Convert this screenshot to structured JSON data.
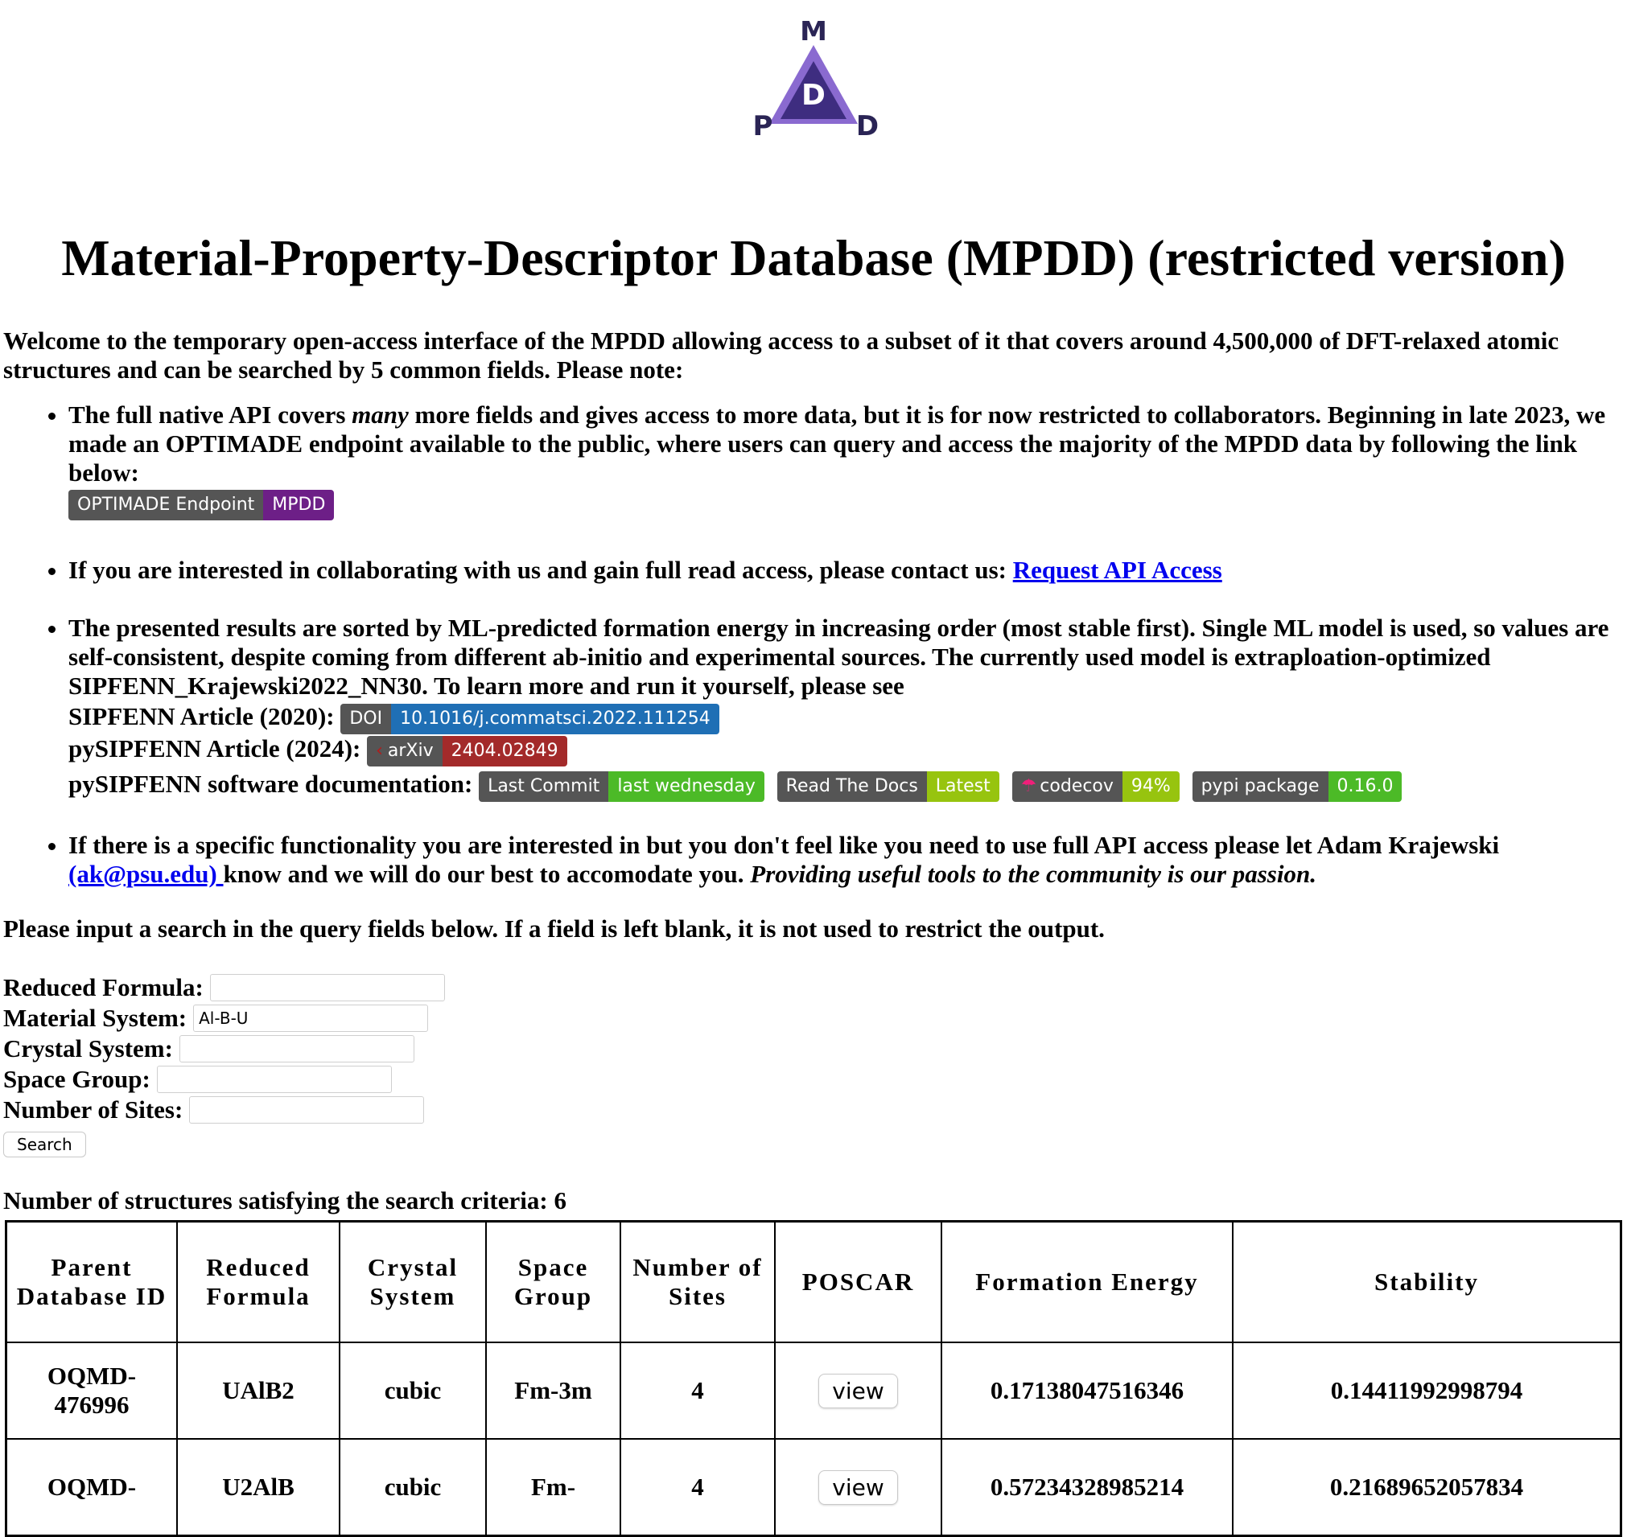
{
  "logo": {
    "top": "M",
    "center": "D",
    "left": "P",
    "right": "D"
  },
  "title": "Material-Property-Descriptor Database (MPDD) (restricted version)",
  "intro": "Welcome to the temporary open-access interface of the MPDD allowing access to a subset of it that covers around 4,500,000 of DFT-relaxed atomic structures and can be searched by 5 common fields. Please note:",
  "bullets": {
    "b1_pre": "The full native API covers ",
    "b1_em": "many",
    "b1_post": " more fields and gives access to more data, but it is for now restricted to collaborators. Beginning in late 2023, we made an OPTIMADE endpoint available to the public, where users can query and access the majority of the MPDD data by following the link below:",
    "b2_text": "If you are interested in collaborating with us and gain full read access, please contact us: ",
    "b2_link": "Request API Access",
    "b3_text": "The presented results are sorted by ML-predicted formation energy in increasing order (most stable first). Single ML model is used, so values are self-consistent, despite coming from different ab-initio and experimental sources. The currently used model is extraploation-optimized SIPFENN_Krajewski2022_NN30. To learn more and run it yourself, please see",
    "b3_sipfenn": "SIPFENN Article (2020):",
    "b3_pysipfenn": "pySIPFENN Article (2024):",
    "b3_docs": "pySIPFENN software documentation:",
    "b4_text": "If there is a specific functionality you are interested in but you don't feel like you need to use full API access please let Adam Krajewski ",
    "b4_link": "(ak@psu.edu) ",
    "b4_post": "know and we will do our best to accomodate you. ",
    "b4_em": "Providing useful tools to the community is our passion."
  },
  "badges": {
    "optimade": {
      "left": "OPTIMADE Endpoint",
      "right": "MPDD"
    },
    "doi": {
      "left": "DOI",
      "right": "10.1016/j.commatsci.2022.111254"
    },
    "arxiv": {
      "left": "arXiv",
      "right": "2404.02849"
    },
    "commit": {
      "left": "Last Commit",
      "right": "last wednesday"
    },
    "rtd": {
      "left": "Read The Docs",
      "right": "Latest"
    },
    "codecov": {
      "left": "codecov",
      "right": "94%"
    },
    "pypi": {
      "left": "pypi package",
      "right": "0.16.0"
    }
  },
  "prompt": "Please input a search in the query fields below. If a field is left blank, it is not used to restrict the output.",
  "form": {
    "reduced_formula_label": "Reduced Formula:",
    "reduced_formula_value": "",
    "material_system_label": "Material System:",
    "material_system_value": "Al-B-U",
    "crystal_system_label": "Crystal System:",
    "crystal_system_value": "",
    "space_group_label": "Space Group:",
    "space_group_value": "",
    "num_sites_label": "Number of Sites:",
    "num_sites_value": "",
    "search_label": "Search"
  },
  "count_text": "Number of structures satisfying the search criteria: 6",
  "table": {
    "headers": [
      "Parent Database ID",
      "Reduced Formula",
      "Crystal System",
      "Space Group",
      "Number of Sites",
      "POSCAR",
      "Formation Energy",
      "Stability"
    ],
    "view_label": "view",
    "rows": [
      [
        "OQMD-476996",
        "UAlB2",
        "cubic",
        "Fm-3m",
        "4",
        "view",
        "0.17138047516346",
        "0.14411992998794"
      ],
      [
        "OQMD-",
        "U2AlB",
        "cubic",
        "Fm-",
        "4",
        "view",
        "0.57234328985214",
        "0.21689652057834"
      ]
    ]
  }
}
